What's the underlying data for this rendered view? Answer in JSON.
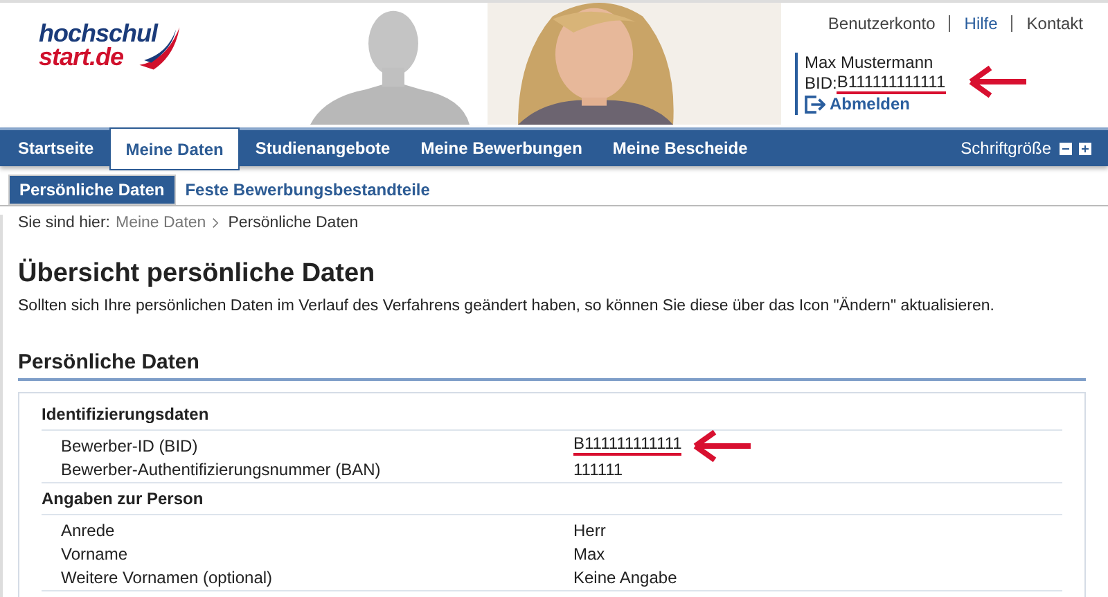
{
  "logo": {
    "line_1": "hochschul",
    "line_2": "start.de"
  },
  "top_links": [
    {
      "label": "Benutzerkonto",
      "active": false
    },
    {
      "label": "Hilfe",
      "active": true
    },
    {
      "label": "Kontakt",
      "active": false
    }
  ],
  "user": {
    "name": "Max Mustermann",
    "bid_label": "BID:",
    "bid": "B111111111111",
    "annotated": true,
    "logout": "Abmelden"
  },
  "nav": [
    {
      "label": "Startseite",
      "selected": false
    },
    {
      "label": "Meine Daten",
      "selected": true
    },
    {
      "label": "Studienangebote",
      "selected": false
    },
    {
      "label": "Meine Bewerbungen",
      "selected": false
    },
    {
      "label": "Meine Bescheide",
      "selected": false
    }
  ],
  "font_size": {
    "label": "Schriftgröße"
  },
  "subnav": [
    {
      "label": "Persönliche Daten",
      "selected": true
    },
    {
      "label": "Feste Bewerbungsbestandteile",
      "selected": false
    }
  ],
  "breadcrumb": {
    "prefix": "Sie sind hier:",
    "items": [
      "Meine Daten",
      "Persönliche Daten"
    ]
  },
  "title": "Übersicht persönliche Daten",
  "intro": "Sollten sich Ihre persönlichen Daten im Verlauf des Verfahrens geändert haben, so können Sie diese über das Icon \"Ändern\" aktualisieren.",
  "section": {
    "title": "Persönliche Daten",
    "groups": [
      {
        "title": "Identifizierungsdaten",
        "rows": [
          {
            "label": "Bewerber-ID (BID)",
            "value": "B111111111111",
            "annotated": true
          },
          {
            "label": "Bewerber-Authentifizierungsnummer (BAN)",
            "value": "111111",
            "annotated": false
          }
        ]
      },
      {
        "title": "Angaben zur Person",
        "rows": [
          {
            "label": "Anrede",
            "value": "Herr",
            "annotated": false
          },
          {
            "label": "Vorname",
            "value": "Max",
            "annotated": false
          },
          {
            "label": "Weitere Vornamen (optional)",
            "value": "Keine Angabe",
            "annotated": false
          }
        ]
      }
    ]
  }
}
